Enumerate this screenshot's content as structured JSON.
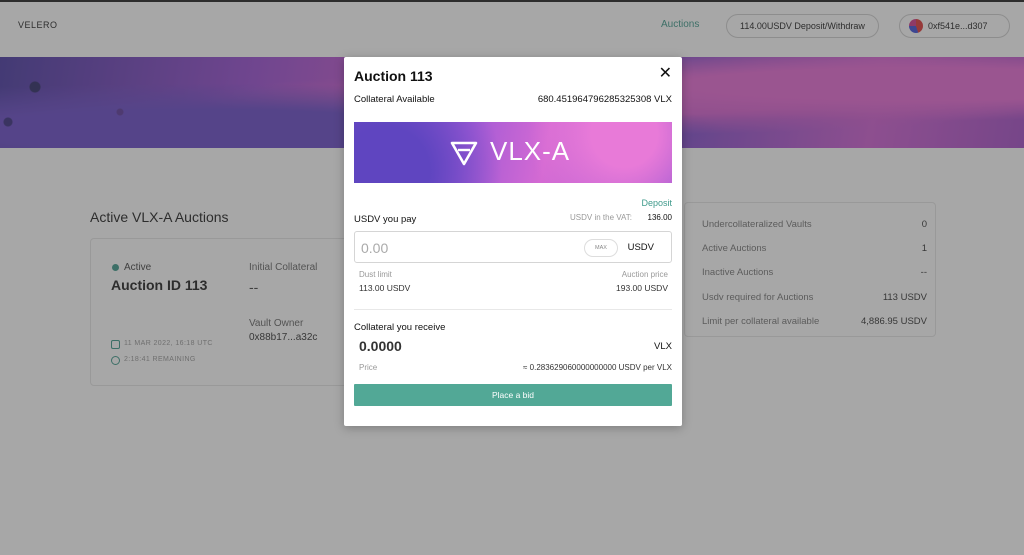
{
  "header": {
    "logo": "VELERO",
    "nav_auctions": "Auctions",
    "deposit_withdraw": "114.00USDV Deposit/Withdraw",
    "wallet": "0xf541e...d307"
  },
  "page": {
    "section_title": "Active VLX-A Auctions",
    "auction_card": {
      "status": "Active",
      "auction_id": "Auction ID 113",
      "initial_collateral_label": "Initial Collateral",
      "initial_collateral_value": "--",
      "vault_owner_label": "Vault Owner",
      "vault_owner_value": "0x88b17...a32c",
      "date": "11 MAR 2022, 16:18 UTC",
      "remaining": "2:18:41 REMAINING"
    },
    "stats": [
      {
        "label": "Undercollateralized Vaults",
        "value": "0"
      },
      {
        "label": "Active Auctions",
        "value": "1"
      },
      {
        "label": "Inactive Auctions",
        "value": "--"
      },
      {
        "label": "Usdv required for Auctions",
        "value": "113 USDV"
      },
      {
        "label": "Limit per collateral available",
        "value": "4,886.95 USDV"
      }
    ]
  },
  "modal": {
    "title": "Auction 113",
    "close_icon": "close-icon",
    "collateral_available_label": "Collateral Available",
    "collateral_available_value": "680.451964796285325308 VLX",
    "token_name": "VLX-A",
    "deposit_link": "Deposit",
    "pay_label": "USDV you pay",
    "vat_label": "USDV in the VAT:",
    "vat_value": "136.00",
    "pay_placeholder": "0.00",
    "max_label": "MAX",
    "pay_unit": "USDV",
    "dust_limit_label": "Dust limit",
    "dust_limit_value": "113.00 USDV",
    "auction_price_label": "Auction price",
    "auction_price_value": "193.00 USDV",
    "receive_label": "Collateral you receive",
    "receive_value": "0.0000",
    "receive_unit": "VLX",
    "price_label": "Price",
    "price_value": "≈ 0.283629060000000000 USDV per VLX",
    "bid_button": "Place a bid"
  },
  "colors": {
    "accent": "#52a896",
    "link": "#3f9a8b"
  }
}
